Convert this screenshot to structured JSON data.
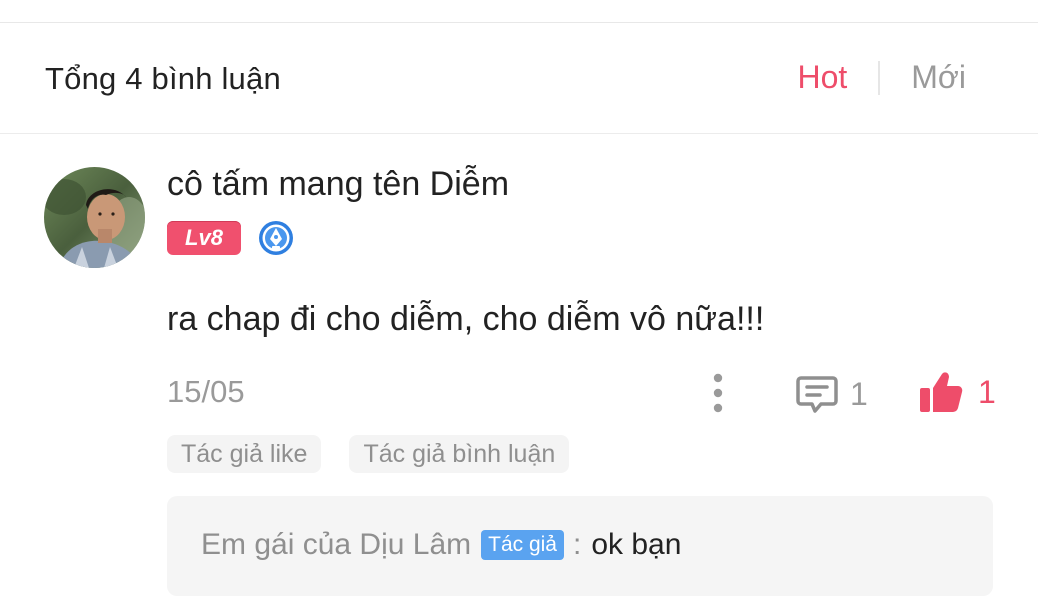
{
  "header": {
    "title": "Tổng 4 bình luận",
    "tabs": {
      "hot": "Hot",
      "new": "Mới"
    }
  },
  "comment": {
    "username": "cô tấm mang tên Diễm",
    "level": "Lv8",
    "text": "ra chap đi cho diễm,  cho diễm vô nữa!!!",
    "date": "15/05",
    "reply_count": "1",
    "like_count": "1",
    "tags": [
      "Tác giả like",
      "Tác giả bình luận"
    ],
    "reply": {
      "author": "Em gái của Dịu Lâm",
      "author_badge": "Tác giả",
      "separator": ":",
      "text": "ok bạn"
    }
  },
  "colors": {
    "accent": "#ee4d6a",
    "level_badge": "#f0506e",
    "author_badge": "#5aa3f0",
    "muted_text": "#9a9a9a"
  },
  "icons": [
    "more-vertical-icon",
    "reply-comment-icon",
    "thumbs-up-icon",
    "pen-badge-icon"
  ]
}
